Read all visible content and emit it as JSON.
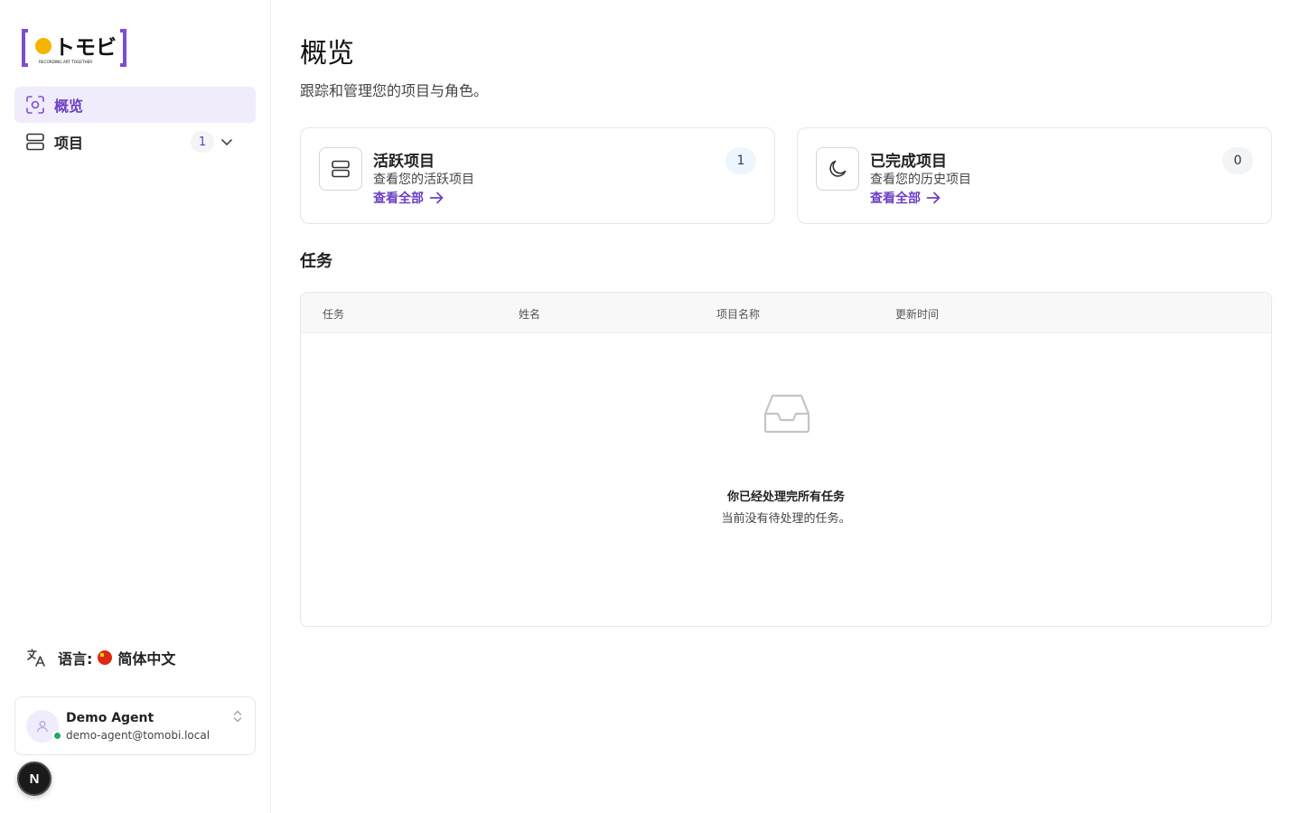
{
  "brand": {
    "logo_text": "トモビ",
    "logo_tagline": "RECORDING ART TOGETHER",
    "accent_color": "#7c4dd6",
    "logo_dot_color": "#f5b400"
  },
  "sidebar": {
    "items": [
      {
        "label": "概览",
        "icon": "scan-icon",
        "active": true
      },
      {
        "label": "项目",
        "icon": "layers-icon",
        "badge": "1",
        "expanded": false
      }
    ],
    "language": {
      "prefix": "语言:",
      "flag": "cn-flag-icon",
      "name": "简体中文"
    },
    "user": {
      "name": "Demo Agent",
      "email": "demo-agent@tomobi.local",
      "status": "online"
    },
    "dev_button": "N"
  },
  "main": {
    "title": "概览",
    "subtitle": "跟踪和管理您的项目与角色。",
    "cards": [
      {
        "title": "活跃项目",
        "description": "查看您的活跃项目",
        "link": "查看全部",
        "count": "1",
        "icon": "layers-icon"
      },
      {
        "title": "已完成项目",
        "description": "查看您的历史项目",
        "link": "查看全部",
        "count": "0",
        "icon": "moon-icon"
      }
    ],
    "tasks": {
      "section_title": "任务",
      "columns": [
        "任务",
        "姓名",
        "项目名称",
        "更新时间"
      ],
      "rows": [],
      "empty_title": "你已经处理完所有任务",
      "empty_description": "当前没有待处理的任务。"
    }
  }
}
